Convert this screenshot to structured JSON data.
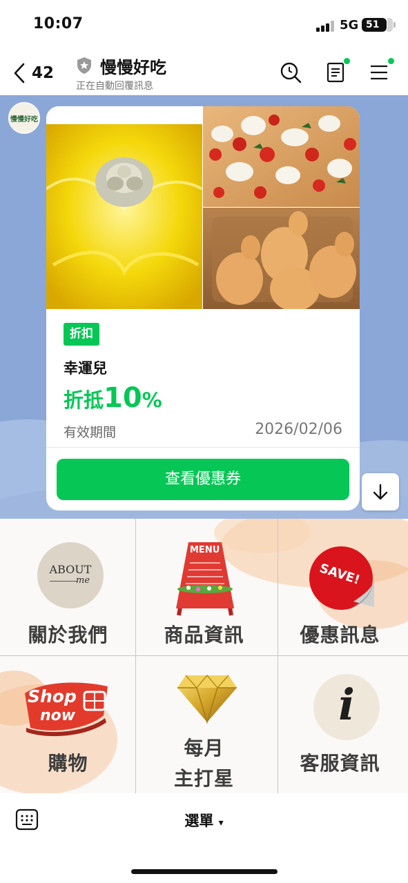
{
  "status_bar": {
    "time": "10:07",
    "network": "5G",
    "battery": "51"
  },
  "header": {
    "back_count": "42",
    "title": "慢慢好吃",
    "subtitle": "正在自動回覆訊息"
  },
  "chat": {
    "avatar_text": "慢慢好吃",
    "coupon": {
      "badge": "折扣",
      "name": "幸運兒",
      "discount_prefix": "折抵",
      "discount_value": "10",
      "discount_unit": "%",
      "validity_label": "有效期間",
      "validity_date": "2026/02/06",
      "button_label": "查看優惠券"
    }
  },
  "rich_menu": {
    "items": [
      {
        "label": "關於我們",
        "icon": "about-me-icon",
        "icon_text_1": "ABOUT",
        "icon_text_2": "me"
      },
      {
        "label": "商品資訊",
        "icon": "menu-board-icon",
        "icon_text_1": "MENU"
      },
      {
        "label": "優惠訊息",
        "icon": "save-sticker-icon",
        "icon_text_1": "SAVE!"
      },
      {
        "label": "購物",
        "icon": "shop-now-icon",
        "icon_text_1": "Shop",
        "icon_text_2": "now"
      },
      {
        "label_line1": "每月",
        "label_line2": "主打星",
        "icon": "diamond-icon"
      },
      {
        "label": "客服資訊",
        "icon": "info-icon",
        "icon_text_1": "i"
      }
    ]
  },
  "bottom_bar": {
    "menu_label": "選單",
    "menu_caret": "▾"
  },
  "colors": {
    "accent_green": "#06c755",
    "chat_bg": "#8aa7d8"
  }
}
